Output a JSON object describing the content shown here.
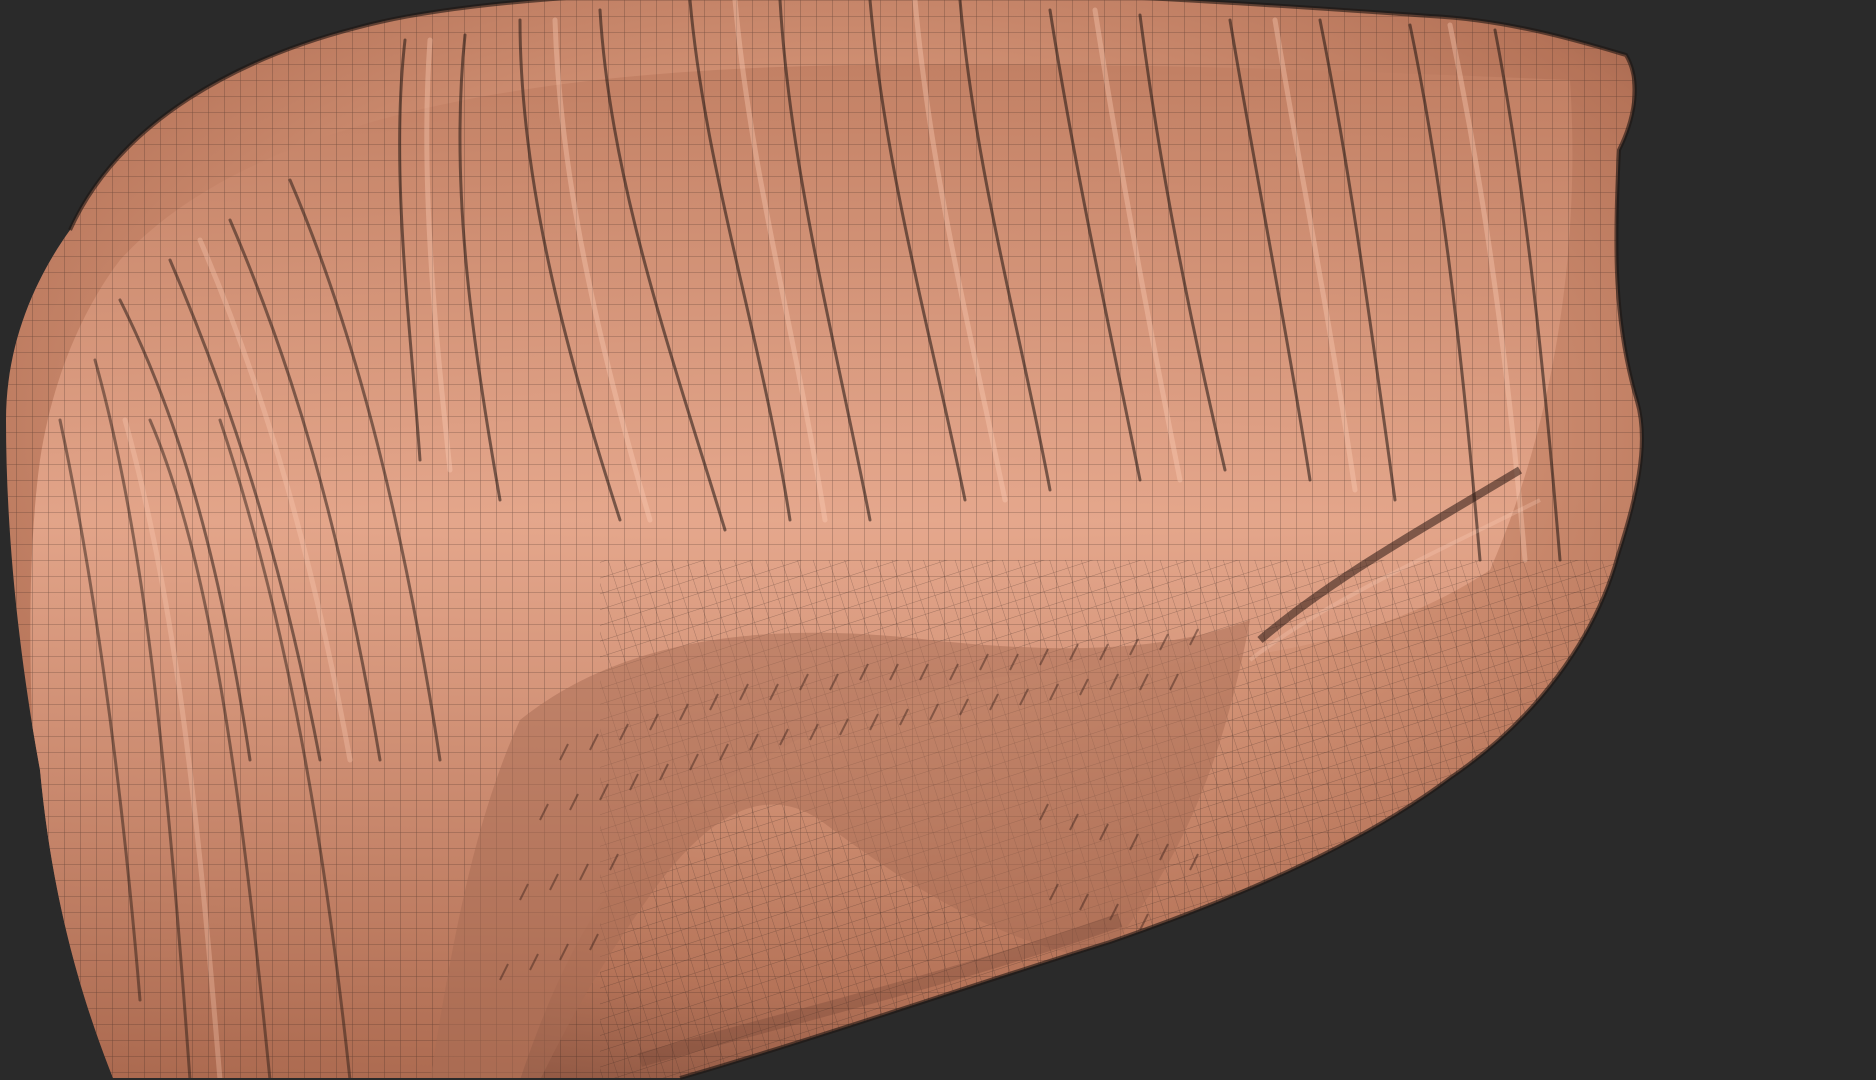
{
  "viewport": {
    "background_color": "#2a2a2a"
  },
  "model": {
    "description_icon": "sculpted-hair-mesh-icon",
    "base_color": "#c98a6e",
    "highlight_color": "#f0b9a1",
    "shadow_color": "#5d3426",
    "wire_color": "#2f1f1a"
  }
}
